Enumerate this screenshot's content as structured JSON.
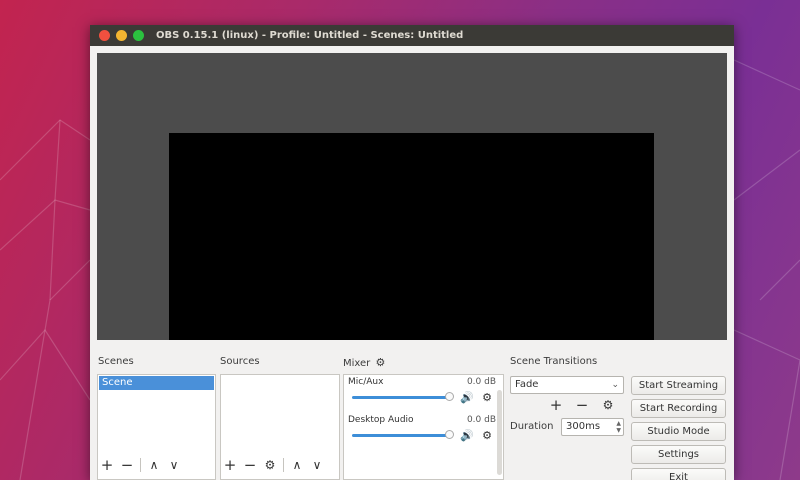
{
  "window": {
    "title": "OBS 0.15.1 (linux) - Profile: Untitled - Scenes: Untitled"
  },
  "docks": {
    "scenes": {
      "title": "Scenes",
      "items": [
        "Scene"
      ],
      "selected_index": 0
    },
    "sources": {
      "title": "Sources",
      "items": []
    },
    "mixer": {
      "title": "Mixer",
      "tracks": [
        {
          "name": "Mic/Aux",
          "level": "0.0 dB",
          "volume_percent": 100
        },
        {
          "name": "Desktop Audio",
          "level": "0.0 dB",
          "volume_percent": 100
        }
      ]
    },
    "transitions": {
      "title": "Scene Transitions",
      "selected": "Fade",
      "duration_label": "Duration",
      "duration_value": "300ms"
    },
    "controls": {
      "start_streaming": "Start Streaming",
      "start_recording": "Start Recording",
      "studio_mode": "Studio Mode",
      "settings": "Settings",
      "exit": "Exit"
    }
  },
  "glyphs": {
    "plus": "+",
    "minus": "−",
    "up": "∧",
    "down": "∨",
    "gear": "⚙",
    "speaker": "🔊",
    "combo_arrow": "⌄",
    "spin": "⌃⌄"
  },
  "colors": {
    "selection": "#4a90d9",
    "volume_bar": "#3d8ed8",
    "titlebar": "#3b3a36",
    "preview_bg": "#4c4c4c",
    "canvas": "#000000"
  }
}
